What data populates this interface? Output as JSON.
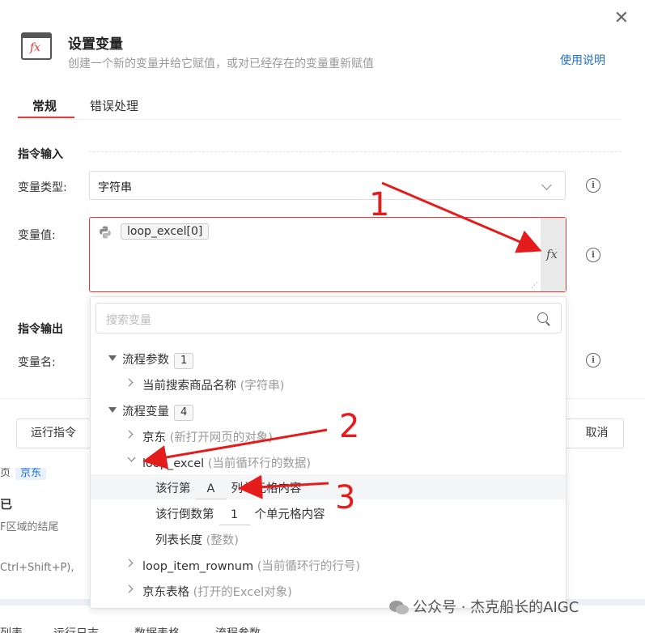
{
  "dialog": {
    "title": "设置变量",
    "subtitle": "创建一个新的变量并给它赋值，或对已经存在的变量重新赋值",
    "help_link": "使用说明",
    "tabs": [
      {
        "label": "常规",
        "active": true
      },
      {
        "label": "错误处理",
        "active": false
      }
    ]
  },
  "input_section": {
    "heading": "指令输入",
    "var_type_label": "变量类型:",
    "var_type_value": "字符串",
    "var_value_label": "变量值:",
    "var_value_chip": "loop_excel[0]"
  },
  "output_section": {
    "heading": "指令输出",
    "var_name_label": "变量名:"
  },
  "footer": {
    "run_label": "运行指令",
    "cancel_label": "取消"
  },
  "dropdown": {
    "search_placeholder": "搜索变量",
    "groups": [
      {
        "label": "流程参数",
        "count": "1",
        "items": [
          {
            "name": "当前搜索商品名称",
            "hint": "(字符串)"
          }
        ]
      },
      {
        "label": "流程变量",
        "count": "4",
        "items": [
          {
            "name": "京东",
            "hint": "(新打开网页的对象)"
          },
          {
            "name": "loop_excel",
            "hint": "(当前循环行的数据)"
          },
          {
            "name": "loop_item_rownum",
            "hint": "(当前循环行的行号)"
          },
          {
            "name": "京东表格",
            "hint": "(打开的Excel对象)"
          }
        ]
      }
    ],
    "sub_items": {
      "row_nth_prefix": "该行第",
      "row_nth_value": "A",
      "row_nth_suffix": "列单元格内容",
      "row_rev_prefix": "该行倒数第",
      "row_rev_value": "1",
      "row_rev_suffix": "个单元格内容",
      "list_len": "列表长度",
      "list_len_hint": "(整数)"
    }
  },
  "annotations": {
    "n1": "1",
    "n2": "2",
    "n3": "3",
    "color": "#e51c1c"
  },
  "background": {
    "crumb_prefix": "页",
    "crumb_tag": "京东",
    "big_text": "已",
    "small1": "F区域的结尾",
    "small2": "Ctrl+Shift+P),",
    "bottom_tabs": [
      "列表",
      "运行日志",
      "数据表格",
      "流程参数"
    ]
  },
  "watermark": "公众号 · 杰克船长的AIGC"
}
